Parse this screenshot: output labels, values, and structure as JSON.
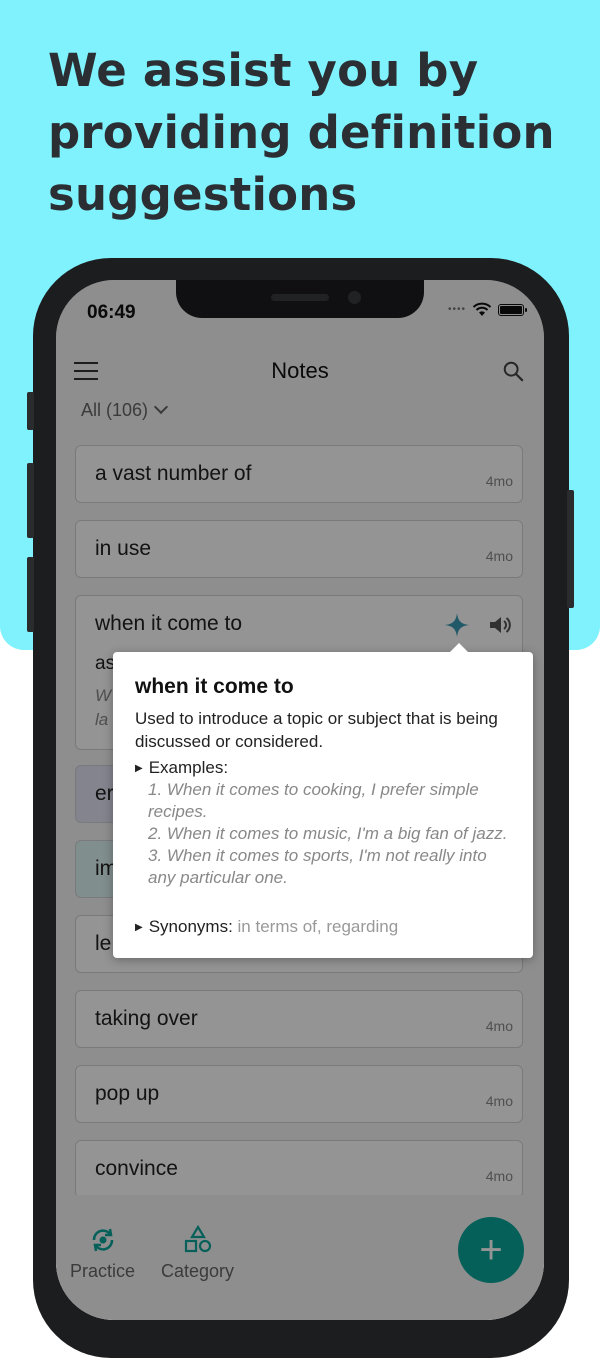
{
  "headline": "We assist you by providing definition suggestions",
  "status_bar": {
    "time": "06:49"
  },
  "app_bar": {
    "title": "Notes"
  },
  "filter": {
    "label": "All (106)"
  },
  "notes": [
    {
      "word": "a vast number of",
      "age": "4mo"
    },
    {
      "word": "in use",
      "age": "4mo"
    },
    {
      "word": "when it come to",
      "partial_line": "as",
      "partial_italic_1": "W",
      "partial_italic_2": "la"
    },
    {
      "word": "er"
    },
    {
      "word": "im"
    },
    {
      "word": "le"
    },
    {
      "word": "taking over",
      "age": "4mo"
    },
    {
      "word": "pop up",
      "age": "4mo"
    },
    {
      "word": "convince",
      "age": "4mo"
    }
  ],
  "popup": {
    "title": "when it come to",
    "definition": "Used to introduce a topic or subject that is being discussed or considered.",
    "examples_label": "Examples:",
    "examples": [
      "1. When it comes to cooking, I prefer simple recipes.",
      "2. When it comes to music, I'm a big fan of jazz.",
      "3. When it comes to sports, I'm not really into any particular one."
    ],
    "synonyms_label": "Synonyms:",
    "synonyms": "in terms of, regarding"
  },
  "bottom_nav": {
    "practice_label": "Practice",
    "category_label": "Category",
    "fab_label": "+"
  },
  "colors": {
    "accent": "#0aa59a",
    "banner": "#7ff2fd",
    "sparkle": "#3b9ab5"
  }
}
